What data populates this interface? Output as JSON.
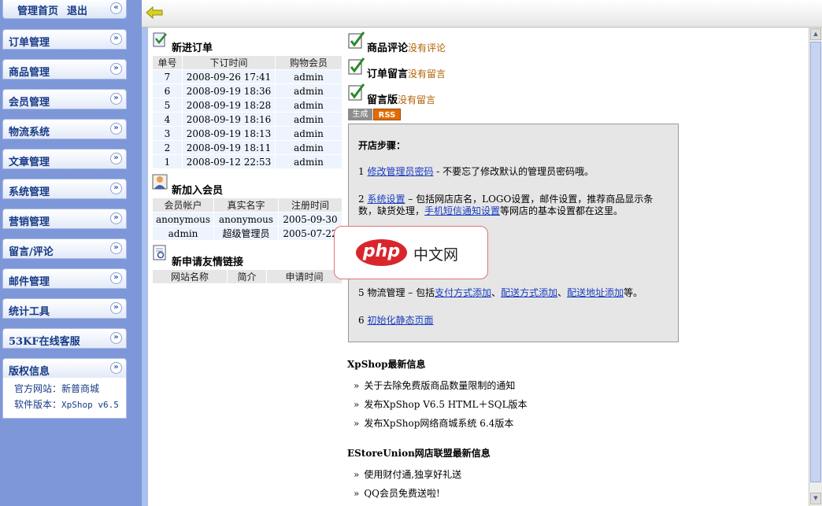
{
  "sidebar": {
    "home": "管理首页",
    "logout": "退出",
    "menu": [
      {
        "label": "订单管理"
      },
      {
        "label": "商品管理"
      },
      {
        "label": "会员管理"
      },
      {
        "label": "物流系统"
      },
      {
        "label": "文章管理"
      },
      {
        "label": "系统管理"
      },
      {
        "label": "营销管理"
      },
      {
        "label": "留言/评论"
      },
      {
        "label": "邮件管理"
      },
      {
        "label": "统计工具"
      },
      {
        "label": "53KF在线客服"
      },
      {
        "label": "版权信息"
      }
    ],
    "copyright": {
      "site_label": "官方网站：",
      "site_link": "新普商城",
      "version_label": "软件版本：",
      "version_value": "XpShop v6.5"
    }
  },
  "orders": {
    "title": "新进订单",
    "headers": [
      "单号",
      "下订时间",
      "购物会员"
    ],
    "rows": [
      [
        "7",
        "2008-09-26 17:41",
        "admin"
      ],
      [
        "6",
        "2008-09-19 18:36",
        "admin"
      ],
      [
        "5",
        "2008-09-19 18:28",
        "admin"
      ],
      [
        "4",
        "2008-09-19 18:16",
        "admin"
      ],
      [
        "3",
        "2008-09-19 18:13",
        "admin"
      ],
      [
        "2",
        "2008-09-19 18:11",
        "admin"
      ],
      [
        "1",
        "2008-09-12 22:53",
        "admin"
      ]
    ]
  },
  "members": {
    "title": "新加入会员",
    "headers": [
      "会员帐户",
      "真实名字",
      "注册时间"
    ],
    "rows": [
      [
        "anonymous",
        "anonymous",
        "2005-09-30"
      ],
      [
        "admin",
        "超级管理员",
        "2005-07-22"
      ]
    ]
  },
  "links": {
    "title": "新申请友情链接",
    "headers": [
      "网站名称",
      "简介",
      "申请时间"
    ]
  },
  "right": {
    "reviews": {
      "title": "商品评论",
      "hint": "没有评论"
    },
    "order_msgs": {
      "title": "订单留言",
      "hint": "没有留言"
    },
    "guestbook": {
      "title": "留言版",
      "hint": "没有留言"
    },
    "rss_gen": "生成",
    "rss": "RSS"
  },
  "steps": {
    "title": "开店步骤：",
    "s1_num": "1 ",
    "s1_link": "修改管理员密码",
    "s1_text": " - 不要忘了修改默认的管理员密码哦。",
    "s2_num": "2 ",
    "s2_link": "系统设置",
    "s2_text": " – 包括网店店名，LOGO设置，邮件设置，推荐商品显示条数，缺货处理，",
    "s2_link2": "手机短信通知设置",
    "s2_text2": "等网店的基本设置都在这里。",
    "s5_num": "5 物流管理 – 包括",
    "s5_link1": "支付方式添加",
    "s5_sep1": "、",
    "s5_link2": "配送方式添加",
    "s5_sep2": "、",
    "s5_link3": "配送地址添加",
    "s5_end": "等。",
    "s6_num": "6 ",
    "s6_link": "初始化静态页面"
  },
  "news": {
    "xpshop_title": "XpShop最新信息",
    "xpshop_items": [
      "关于去除免费版商品数量限制的通知",
      "发布XpShop V6.5 HTML＋SQL版本",
      "发布XpShop网络商城系统 6.4版本"
    ],
    "estore_title": "EStoreUnion网店联盟最新信息",
    "estore_items": [
      "使用财付通,独享好礼送",
      "QQ会员免费送啦!"
    ],
    "bullet": "»"
  },
  "watermark": {
    "text": "php",
    "cn": "中文网"
  }
}
